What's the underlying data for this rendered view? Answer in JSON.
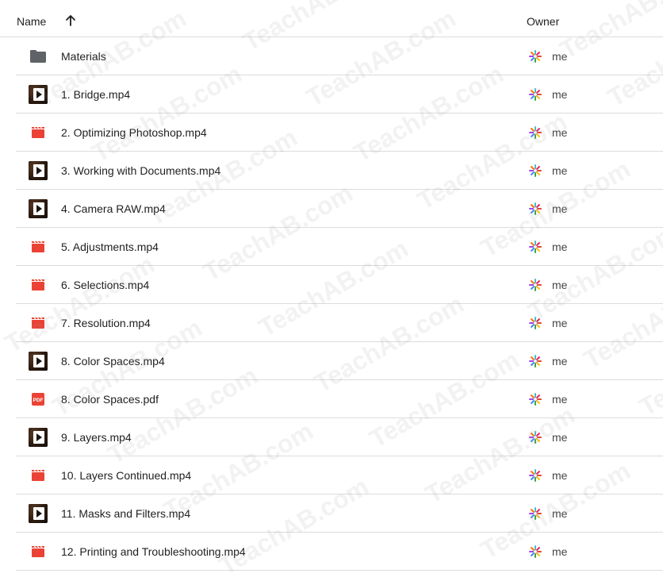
{
  "header": {
    "name_label": "Name",
    "owner_label": "Owner",
    "sort_icon": "arrow-up-icon"
  },
  "files": [
    {
      "name": "Materials",
      "type": "folder",
      "owner": "me"
    },
    {
      "name": "1. Bridge.mp4",
      "type": "video-thumb",
      "owner": "me"
    },
    {
      "name": "2. Optimizing Photoshop.mp4",
      "type": "video",
      "owner": "me"
    },
    {
      "name": "3. Working with Documents.mp4",
      "type": "video-thumb",
      "owner": "me"
    },
    {
      "name": "4. Camera RAW.mp4",
      "type": "video-thumb",
      "owner": "me"
    },
    {
      "name": "5. Adjustments.mp4",
      "type": "video",
      "owner": "me"
    },
    {
      "name": "6. Selections.mp4",
      "type": "video",
      "owner": "me"
    },
    {
      "name": "7. Resolution.mp4",
      "type": "video",
      "owner": "me"
    },
    {
      "name": "8. Color Spaces.mp4",
      "type": "video-thumb",
      "owner": "me"
    },
    {
      "name": "8. Color Spaces.pdf",
      "type": "pdf",
      "owner": "me"
    },
    {
      "name": "9. Layers.mp4",
      "type": "video-thumb",
      "owner": "me"
    },
    {
      "name": "10. Layers Continued.mp4",
      "type": "video",
      "owner": "me"
    },
    {
      "name": "11. Masks and Filters.mp4",
      "type": "video-thumb",
      "owner": "me"
    },
    {
      "name": "12. Printing and Troubleshooting.mp4",
      "type": "video",
      "owner": "me"
    }
  ],
  "watermark": "TeachAB.com",
  "colors": {
    "folder": "#5f6368",
    "video": "#ea4335",
    "pdf": "#ea4335",
    "divider": "#dadce0"
  }
}
